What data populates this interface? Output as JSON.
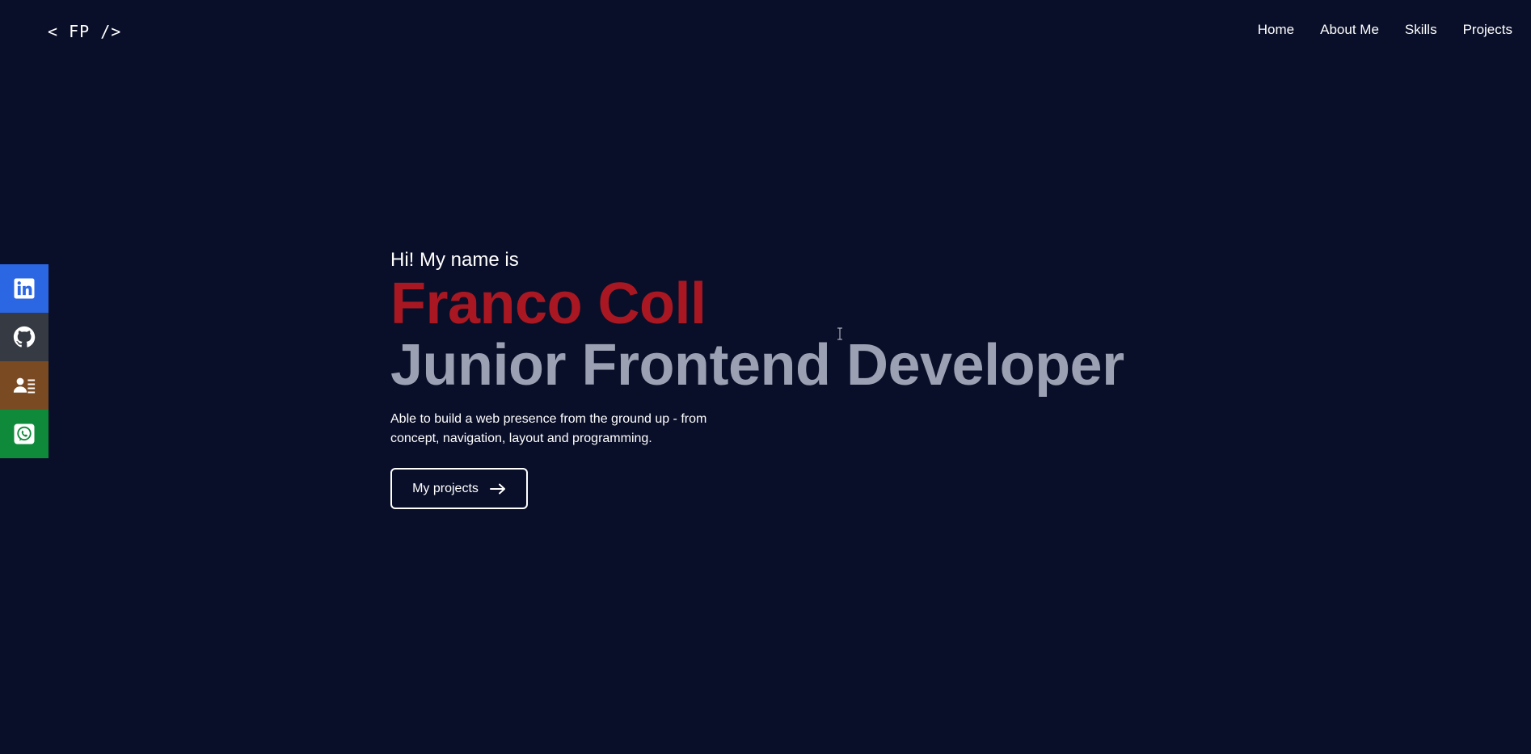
{
  "header": {
    "logo": "< FP />",
    "nav": [
      "Home",
      "About Me",
      "Skills",
      "Projects"
    ]
  },
  "social": [
    {
      "name": "linkedin",
      "icon": "linkedin-icon",
      "color": "#2b66e3"
    },
    {
      "name": "github",
      "icon": "github-icon",
      "color": "#363a42"
    },
    {
      "name": "resume",
      "icon": "contact-card-icon",
      "color": "#7a4a22"
    },
    {
      "name": "whatsapp",
      "icon": "whatsapp-icon",
      "color": "#0f8a3a"
    }
  ],
  "hero": {
    "greeting": "Hi! My name is",
    "name": "Franco Coll",
    "role": "Junior Frontend Developer",
    "description": "Able to build a web presence from the ground up - from concept, navigation, layout and programming.",
    "cta_label": "My projects"
  },
  "colors": {
    "background": "#0a0f29",
    "accent": "#a91822",
    "muted": "#9ba0b3"
  }
}
